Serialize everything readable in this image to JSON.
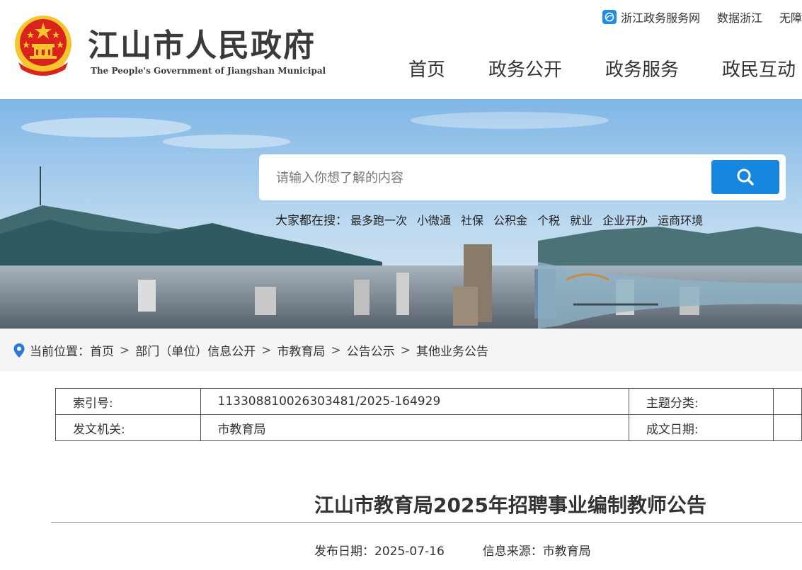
{
  "header": {
    "title": "江山市人民政府",
    "subtitle": "The People's Government of Jiangshan Municipal"
  },
  "toplinks": [
    {
      "label": "浙江政务服务网"
    },
    {
      "label": "数据浙江"
    },
    {
      "label": "无障"
    }
  ],
  "nav": [
    {
      "label": "首页"
    },
    {
      "label": "政务公开"
    },
    {
      "label": "政务服务"
    },
    {
      "label": "政民互动"
    }
  ],
  "search": {
    "placeholder": "请输入你想了解的内容",
    "hot_label": "大家都在搜：",
    "hot_items": [
      "最多跑一次",
      "小微通",
      "社保",
      "公积金",
      "个税",
      "就业",
      "企业开办",
      "运商环境"
    ]
  },
  "breadcrumb": {
    "label": "当前位置：",
    "items": [
      "首页",
      "部门（单位）信息公开",
      "市教育局",
      "公告公示",
      "其他业务公告"
    ],
    "separator": ">"
  },
  "info": {
    "index_label": "索引号:",
    "index_value": "113308810026303481/2025-164929",
    "topic_label": "主题分类:",
    "topic_value": "",
    "issuer_label": "发文机关:",
    "issuer_value": "市教育局",
    "date_label": "成文日期:",
    "date_value": ""
  },
  "article": {
    "title": "江山市教育局2025年招聘事业编制教师公告",
    "publish_date": "发布日期：2025-07-16",
    "source": "信息来源：市教育局"
  },
  "colors": {
    "accent": "#1686de",
    "emblem_red": "#d9231c",
    "emblem_gold": "#f6c42b"
  }
}
